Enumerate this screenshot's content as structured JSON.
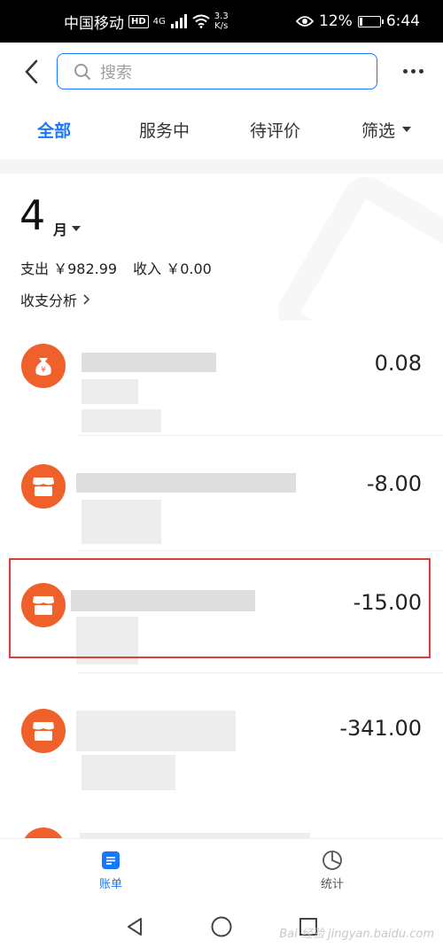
{
  "status_bar": {
    "carrier": "中国移动",
    "hd": "HD",
    "network": "4G",
    "net_speed_value": "3.3",
    "net_speed_unit": "K/s",
    "battery": "12%",
    "battery_level": 0.12,
    "time": "6:44"
  },
  "search": {
    "placeholder": "搜索"
  },
  "tabs": [
    {
      "label": "全部",
      "active": true
    },
    {
      "label": "服务中",
      "active": false
    },
    {
      "label": "待评价",
      "active": false
    },
    {
      "label": "筛选",
      "active": false
    }
  ],
  "month": {
    "number": "4",
    "unit": "月",
    "expense_label": "支出",
    "expense_value": "￥982.99",
    "income_label": "收入",
    "income_value": "￥0.00",
    "analysis_label": "收支分析"
  },
  "transactions": [
    {
      "icon": "money-bag-icon",
      "amount": "0.08"
    },
    {
      "icon": "store-icon",
      "amount": "-8.00"
    },
    {
      "icon": "store-icon",
      "amount": "-15.00"
    },
    {
      "icon": "store-icon",
      "amount": "-341.00"
    }
  ],
  "bottom_nav": [
    {
      "label": "账单",
      "icon": "bill-icon",
      "active": true
    },
    {
      "label": "统计",
      "icon": "pie-chart-icon",
      "active": false
    }
  ],
  "watermark": "Bai 经验 jingyan.baidu.com",
  "colors": {
    "accent": "#1677ff",
    "icon_orange": "#f0602a",
    "highlight": "#e03c3c"
  }
}
